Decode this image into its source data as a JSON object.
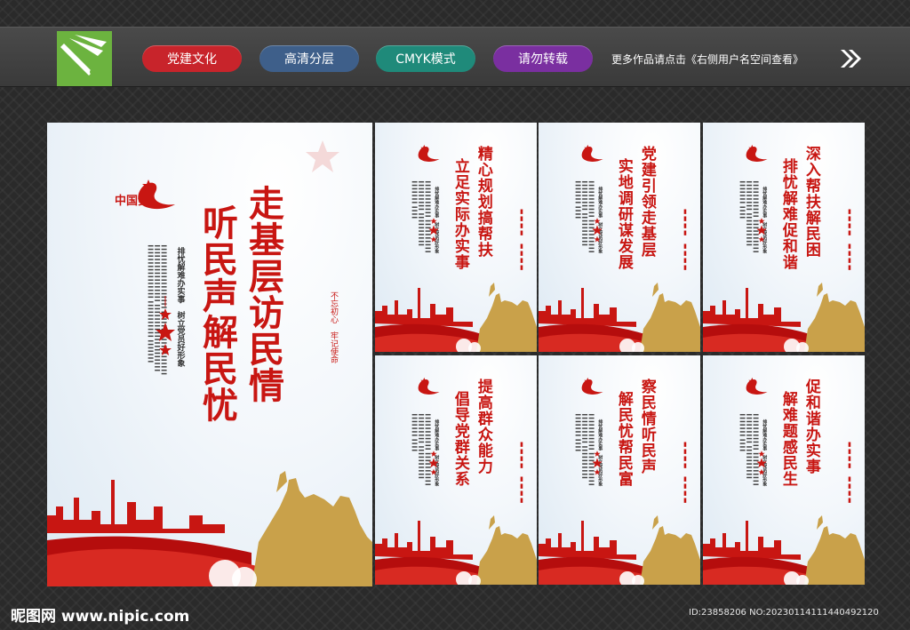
{
  "topbar": {
    "tags": [
      {
        "label": "党建文化",
        "color": "#c8242b"
      },
      {
        "label": "高清分层",
        "color": "#3e5f8a"
      },
      {
        "label": "CMYK模式",
        "color": "#1f8a7a"
      },
      {
        "label": "请勿转载",
        "color": "#7a2fa0"
      }
    ],
    "more_text": "更多作品请点击《右侧用户名空间查看》"
  },
  "main_poster": {
    "title_line1": "走基层访民情",
    "title_line2": "听民声解民忧",
    "subtitle": "排忧解难办实事　树立党员好形象",
    "stamp": "不忘初心　牢记使命",
    "logo_text": "中国梦"
  },
  "panels": [
    {
      "title_line1": "精心规划搞帮扶",
      "title_line2": "立足实际办实事",
      "subtitle": "排忧解难办实事　树立党员好形象"
    },
    {
      "title_line1": "党建引领走基层",
      "title_line2": "实地调研谋发展",
      "subtitle": "排忧解难办实事　树立党员好形象"
    },
    {
      "title_line1": "深入帮扶解民困",
      "title_line2": "排忧解难促和谐",
      "subtitle": "排忧解难办实事　树立党员好形象"
    },
    {
      "title_line1": "提高群众能力",
      "title_line2": "倡导党群关系",
      "subtitle": "排忧解难办实事　树立党员好形象"
    },
    {
      "title_line1": "察民情听民声",
      "title_line2": "解民忧帮民富",
      "subtitle": "排忧解难办实事　树立党员好形象"
    },
    {
      "title_line1": "促和谐办实事",
      "title_line2": "解难题感民生",
      "subtitle": "排忧解难办实事　树立党员好形象"
    }
  ],
  "footer": {
    "site": "昵图网 www.nipic.com",
    "id_text": "ID:23858206 NO:20230114111440492120"
  },
  "colors": {
    "accent_red": "#c81612",
    "gold": "#c9a14a"
  }
}
